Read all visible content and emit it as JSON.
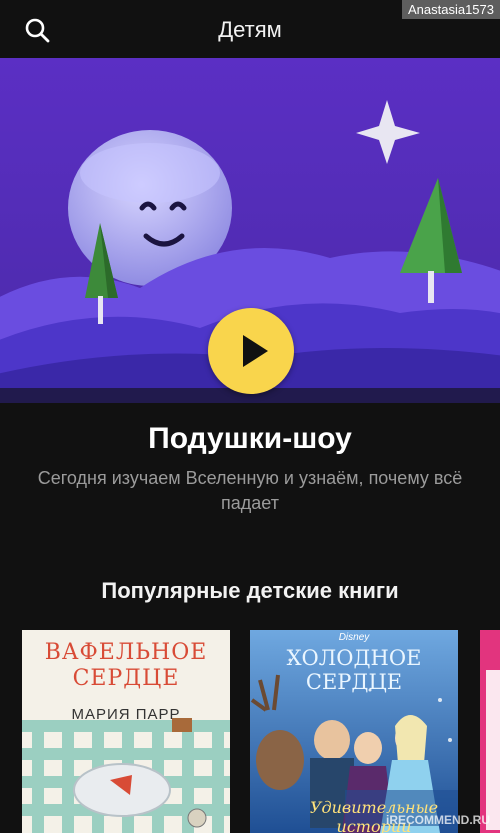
{
  "header": {
    "title": "Детям",
    "search_icon": "search-icon"
  },
  "watermark_top": "Anastasia1573",
  "hero": {
    "show_title": "Подушки-шоу",
    "description": "Сегодня изучаем Вселенную и узнаём, почему всё падает",
    "play_icon": "play-icon",
    "colors": {
      "sky": "#5a2fc9",
      "hills": "#6a4de0",
      "play": "#f9d54c"
    }
  },
  "books_section": {
    "title": "Популярные детские книги",
    "books": [
      {
        "title_line1": "ВАФЕЛЬНОЕ",
        "title_line2": "СЕРДЦЕ",
        "author": "МАРИЯ ПАРР"
      },
      {
        "brand": "Disney",
        "title_line1": "ХОЛОДНОЕ",
        "title_line2": "СЕРДЦЕ",
        "subtitle": "Удивительные истории"
      },
      {
        "title_line1": ""
      }
    ]
  },
  "watermark_bottom": "iRECOMMEND.RU"
}
